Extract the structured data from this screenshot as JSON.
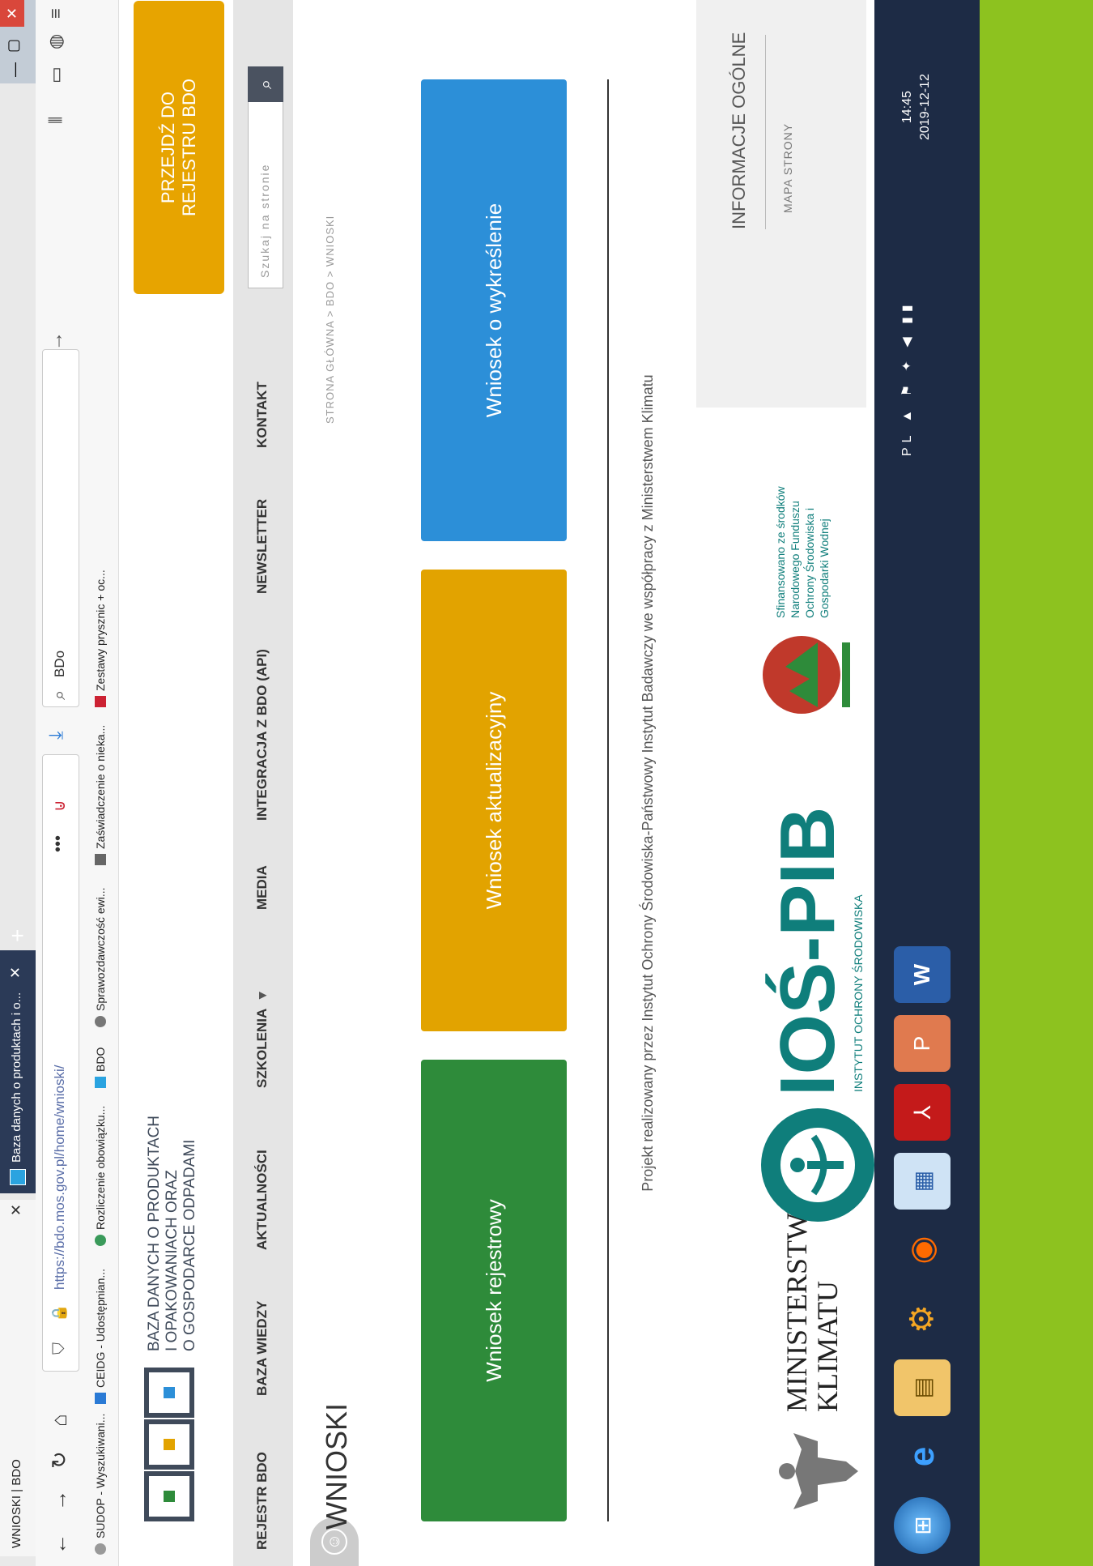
{
  "browser": {
    "window_title": "WNIOSKI | BDO",
    "active_tab_label": "Baza danych o produktach i o...",
    "new_tab_icon": "+",
    "url": "https://bdo.mos.gov.pl/home/wnioski/",
    "search_text": "BDo",
    "bookmarks": [
      "SUDOP - Wyszukiwani...",
      "CEIDG - Udostępnian...",
      "Rozliczenie obowiązku...",
      "BDO",
      "Sprawozdawczość ewi...",
      "Zaświadczenie o nieka...",
      "Zestawy prysznic + oc..."
    ]
  },
  "site": {
    "title_line1": "BAZA DANYCH O PRODUKTACH",
    "title_line2": "I OPAKOWANIACH ORAZ",
    "title_line3": "O GOSPODARCE ODPADAMI",
    "cta_line1": "PRZEJDŹ DO",
    "cta_line2": "REJESTRU BDO",
    "nav": [
      "REJESTR BDO",
      "BAZA WIEDZY",
      "AKTUALNOŚCI",
      "SZKOLENIA",
      "MEDIA",
      "INTEGRACJA Z BDO (API)",
      "NEWSLETTER",
      "KONTAKT"
    ],
    "search_placeholder": "Szukaj na stronie",
    "page_heading": "WNIOSKI",
    "breadcrumb": "STRONA GŁÓWNA  >  BDO  >  WNIOSKI",
    "tiles": [
      {
        "label": "Wniosek rejestrowy",
        "color": "#2e8b3a"
      },
      {
        "label": "Wniosek aktualizacyjny",
        "color": "#e2a300"
      },
      {
        "label": "Wniosek o wykreślenie",
        "color": "#2c8fd8"
      }
    ],
    "project_text": "Projekt realizowany przez Instytut Ochrony Środowiska-Państwowy Instytut Badawczy we współpracy z Ministerstwem Klimatu",
    "footer": {
      "ministry_line1": "MINISTERSTWO",
      "ministry_line2": "KLIMATU",
      "ios_name": "IOŚ-PIB",
      "ios_sub": "INSTYTUT OCHRONY ŚRODOWISKA",
      "nf_text": "Sfinansowano ze środków Narodowego Funduszu Ochrony Środowiska i Gospodarki Wodnej",
      "info_heading": "INFORMACJE OGÓLNE",
      "sitemap": "MAPA STRONY"
    }
  },
  "taskbar": {
    "lang": "PL",
    "time": "14:45",
    "date": "2019-12-12"
  }
}
